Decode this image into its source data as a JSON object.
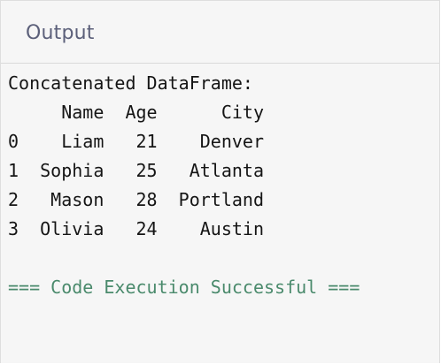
{
  "panel": {
    "title": "Output"
  },
  "output": {
    "heading": "Concatenated DataFrame:",
    "table": {
      "columns": [
        "",
        "Name",
        "Age",
        "City"
      ],
      "rows": [
        [
          "0",
          "Liam",
          "21",
          "Denver"
        ],
        [
          "1",
          "Sophia",
          "25",
          "Atlanta"
        ],
        [
          "2",
          "Mason",
          "28",
          "Portland"
        ],
        [
          "3",
          "Olivia",
          "24",
          "Austin"
        ]
      ]
    },
    "status": "=== Code Execution Successful ===",
    "status_color": "#4a8a6c"
  }
}
